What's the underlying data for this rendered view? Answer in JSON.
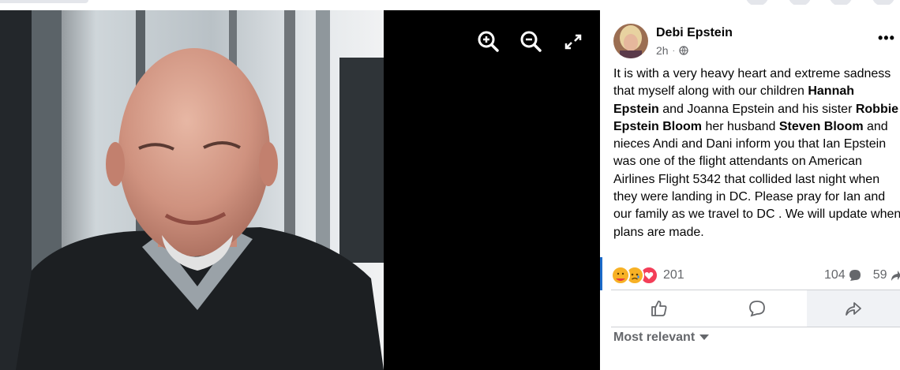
{
  "post": {
    "author": "Debi Epstein",
    "time": "2h",
    "privacy_icon": "globe-icon",
    "more_label": "•••",
    "body": [
      {
        "t": "It is with a very heavy heart and extreme sadness that myself along with our children "
      },
      {
        "t": "Hannah Epstein",
        "b": true
      },
      {
        "t": " and Joanna Epstein and his sister "
      },
      {
        "t": "Robbie Epstein Bloom",
        "b": true
      },
      {
        "t": " her husband "
      },
      {
        "t": "Steven Bloom",
        "b": true
      },
      {
        "t": " and nieces Andi and Dani inform you that Ian Epstein was one of the flight attendants on American Airlines Flight 5342 that collided last night when they were landing in DC. Please pray for Ian and our family as we travel to DC . We will update when plans are made."
      }
    ]
  },
  "engagement": {
    "reactions": [
      "care",
      "sad",
      "love"
    ],
    "reactions_count": "201",
    "comments_count": "104",
    "shares_count": "59"
  },
  "actions": [
    "like",
    "comment",
    "share"
  ],
  "comments": {
    "sort_label": "Most relevant"
  },
  "viewer_controls": [
    "zoom-in",
    "zoom-out",
    "fullscreen"
  ],
  "colors": {
    "accent": "#1b6ac9",
    "secondary_text": "#65676b",
    "primary_text": "#050505"
  }
}
